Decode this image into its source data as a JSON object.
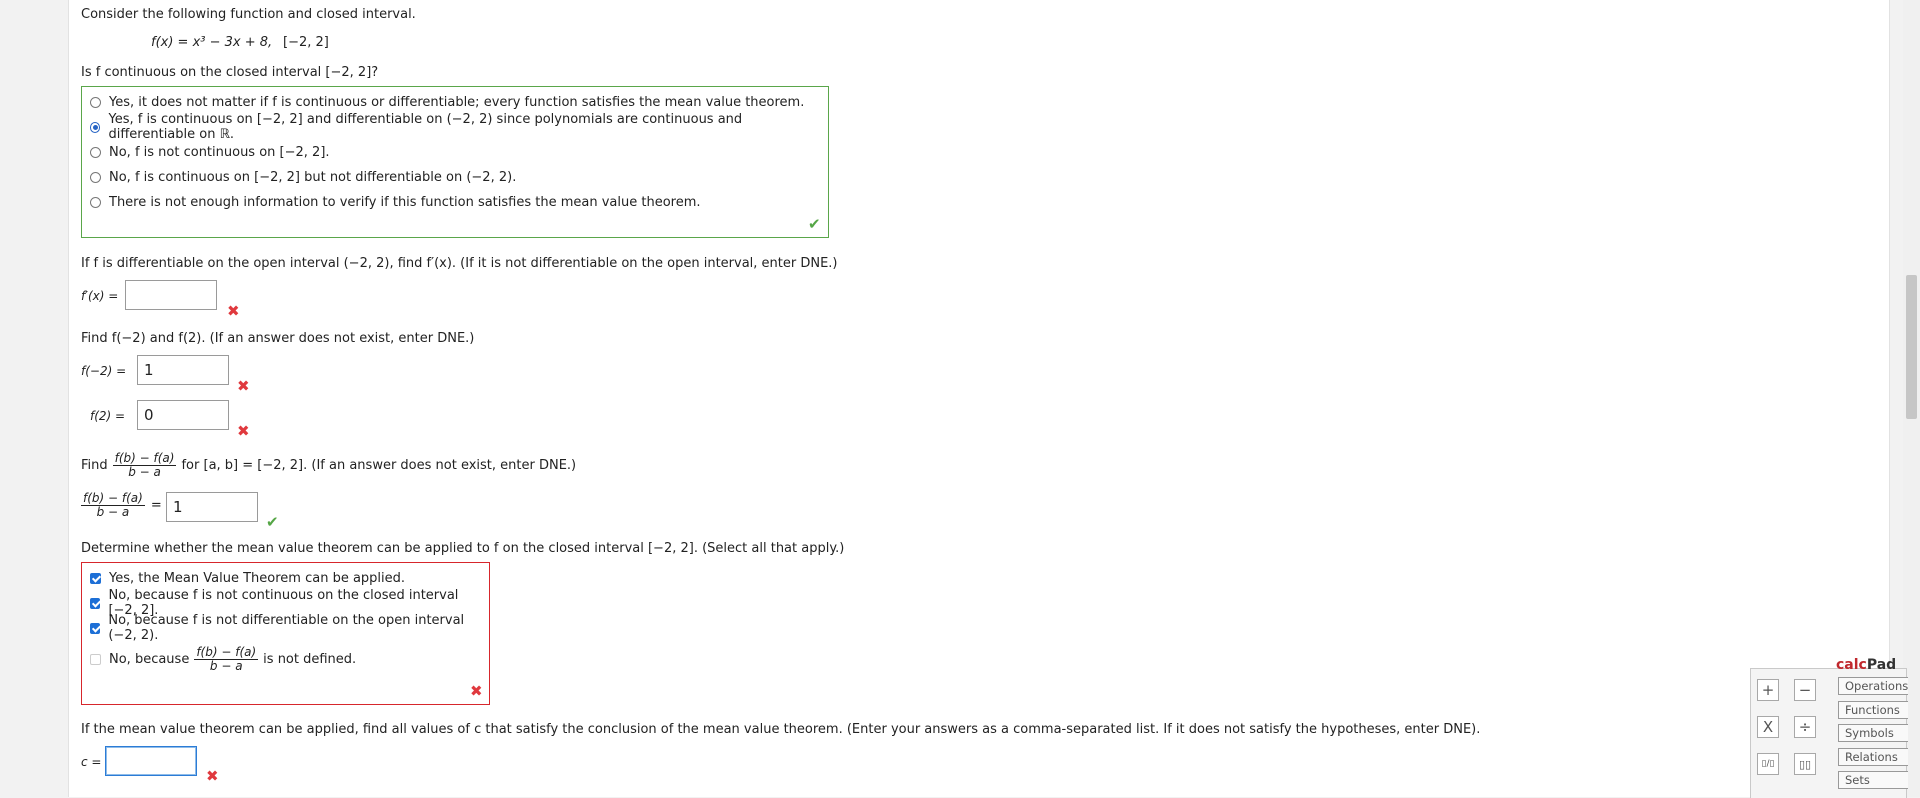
{
  "q1": {
    "intro": "Consider the following function and closed interval.",
    "function": "f(x) = x³ − 3x + 8,",
    "interval": "[−2, 2]",
    "question": "Is f continuous on the closed interval [−2, 2]?",
    "options": [
      "Yes, it does not matter if f is continuous or differentiable; every function satisfies the mean value theorem.",
      "Yes, f is continuous on [−2, 2] and differentiable on (−2, 2) since polynomials are continuous and differentiable on ℝ.",
      "No, f is not continuous on [−2, 2].",
      "No, f is continuous on [−2, 2] but not differentiable on (−2, 2).",
      "There is not enough information to verify if this function satisfies the mean value theorem."
    ]
  },
  "q2": {
    "prompt": "If f is differentiable on the open interval (−2, 2), find f′(x). (If it is not differentiable on the open interval, enter DNE.)",
    "label": "f′(x)  =",
    "value": ""
  },
  "q3": {
    "prompt": "Find f(−2) and f(2). (If an answer does not exist, enter DNE.)",
    "label_a": "f(−2)  =",
    "value_a": "1",
    "label_b": "f(2)  =",
    "value_b": "0"
  },
  "q4": {
    "find": "Find",
    "frac_num": "f(b) − f(a)",
    "frac_den": "b − a",
    "rest": "for [a, b] = [−2, 2]. (If an answer does not exist, enter DNE.)",
    "equals": "=",
    "value": "1"
  },
  "q5": {
    "prompt": "Determine whether the mean value theorem can be applied to f on the closed interval [−2, 2]. (Select all that apply.)",
    "options": [
      "Yes, the Mean Value Theorem can be applied.",
      "No, because f is not continuous on the closed interval [−2, 2].",
      "No, because f is not differentiable on the open interval (−2, 2).",
      "No, because",
      "is not defined."
    ]
  },
  "q6": {
    "prompt": "If the mean value theorem can be applied, find all values of c that satisfy the conclusion of the mean value theorem. (Enter your answers as a comma-separated list. If it does not satisfy the hypotheses, enter DNE).",
    "label": "c  =",
    "value": ""
  },
  "calcpad": {
    "title_a": "calc",
    "title_b": "Pad",
    "tabs": [
      "Operations",
      "Functions",
      "Symbols",
      "Relations",
      "Sets"
    ],
    "keys": [
      "+",
      "−",
      "X",
      "÷",
      "▯/▯",
      "▯▯"
    ]
  },
  "colors": {
    "correct": "#55a646",
    "incorrect": "#e0393e",
    "accent": "#1d6fd6"
  }
}
